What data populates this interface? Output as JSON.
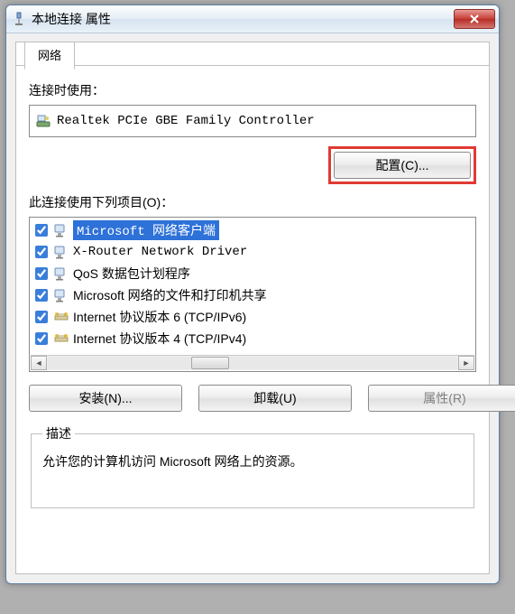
{
  "window": {
    "title": "本地连接 属性",
    "close": "X"
  },
  "tab": {
    "label": "网络"
  },
  "adapter": {
    "label": "连接时使用：",
    "name": "Realtek PCIe GBE Family Controller"
  },
  "buttons": {
    "configure": "配置(C)...",
    "install": "安装(N)...",
    "uninstall": "卸载(U)",
    "properties": "属性(R)"
  },
  "items": {
    "label": "此连接使用下列项目(O)：",
    "list": [
      {
        "checked": true,
        "text": "Microsoft 网络客户端",
        "icon": "client",
        "selected": true
      },
      {
        "checked": true,
        "text": "X-Router Network Driver",
        "icon": "client"
      },
      {
        "checked": true,
        "text": "QoS 数据包计划程序",
        "icon": "service"
      },
      {
        "checked": true,
        "text": "Microsoft 网络的文件和打印机共享",
        "icon": "service"
      },
      {
        "checked": true,
        "text": "Internet 协议版本 6 (TCP/IPv6)",
        "icon": "protocol"
      },
      {
        "checked": true,
        "text": "Internet 协议版本 4 (TCP/IPv4)",
        "icon": "protocol"
      }
    ]
  },
  "description": {
    "legend": "描述",
    "text": "允许您的计算机访问 Microsoft 网络上的资源。"
  }
}
